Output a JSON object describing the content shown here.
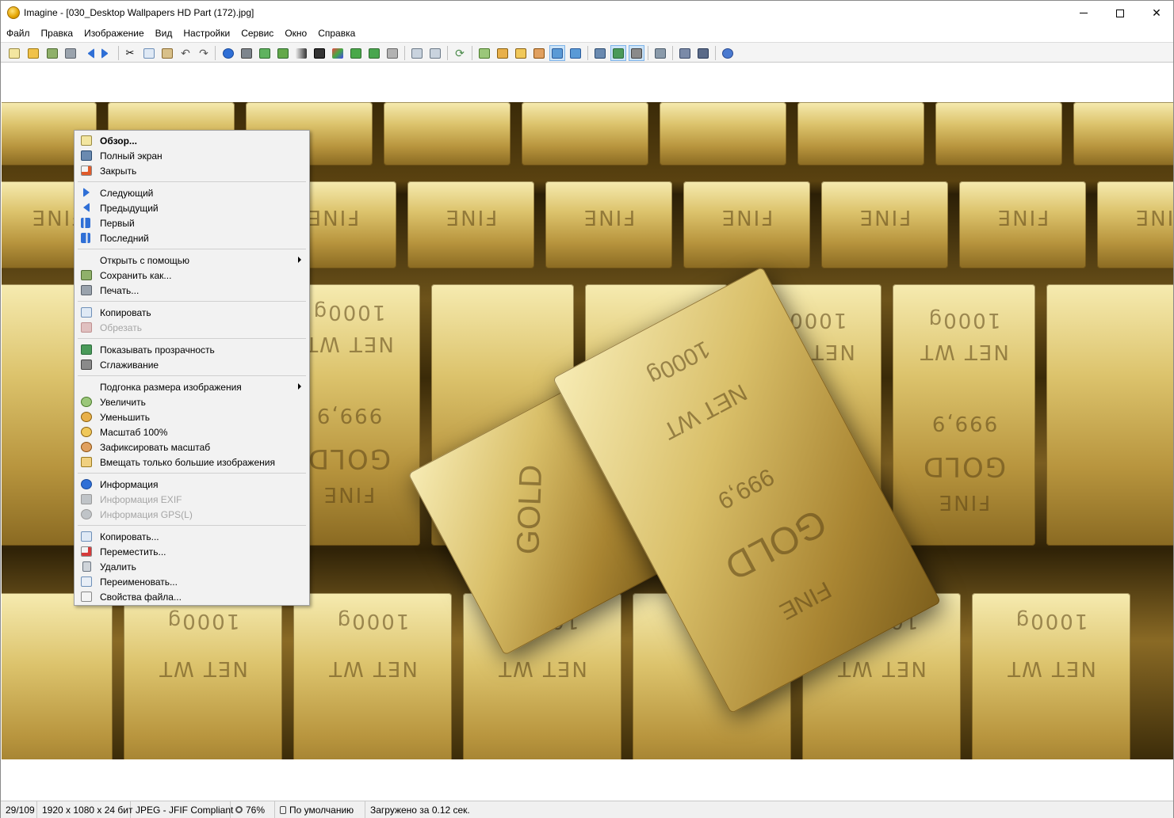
{
  "window": {
    "title": "Imagine - [030_Desktop Wallpapers  HD Part (172).jpg]"
  },
  "menubar": {
    "items": [
      "Файл",
      "Правка",
      "Изображение",
      "Вид",
      "Настройки",
      "Сервис",
      "Окно",
      "Справка"
    ]
  },
  "toolbar": {
    "icons": [
      "browse-icon",
      "open-icon",
      "save-icon",
      "print-icon",
      "previous-icon",
      "next-icon",
      "cut-icon",
      "copy-icon",
      "paste-icon",
      "undo-icon",
      "redo-icon",
      "info-icon",
      "exif-icon",
      "crop-icon",
      "print-preview-icon",
      "grayscale-icon",
      "negative-icon",
      "effects-icon",
      "rotate-icon",
      "flip-icon",
      "wand-icon",
      "zoom-in-icon",
      "zoom-out-icon",
      "refresh-icon",
      "zoom-tool-icon",
      "zoom-in-icon",
      "zoom-out-icon",
      "fit-icon",
      "fit-active-icon",
      "fit-large-icon",
      "fullscreen-icon",
      "slideshow-icon",
      "smooth-icon",
      "settings-icon",
      "screen-capture-icon",
      "batch-icon",
      "help-icon"
    ]
  },
  "context_menu": {
    "items": [
      {
        "label": "Обзор...",
        "icon": "browse-icon",
        "bold": true
      },
      {
        "label": "Полный экран",
        "icon": "monitor-icon"
      },
      {
        "label": "Закрыть",
        "icon": "close-doc-icon"
      },
      {
        "separator": true
      },
      {
        "label": "Следующий",
        "icon": "next-icon"
      },
      {
        "label": "Предыдущий",
        "icon": "previous-icon"
      },
      {
        "label": "Первый",
        "icon": "first-icon"
      },
      {
        "label": "Последний",
        "icon": "last-icon"
      },
      {
        "separator": true
      },
      {
        "label": "Открыть с помощью",
        "submenu": true
      },
      {
        "label": "Сохранить как...",
        "icon": "save-as-icon"
      },
      {
        "label": "Печать...",
        "icon": "print-icon"
      },
      {
        "separator": true
      },
      {
        "label": "Копировать",
        "icon": "copy-icon"
      },
      {
        "label": "Обрезать",
        "icon": "crop-icon",
        "disabled": true
      },
      {
        "separator": true
      },
      {
        "label": "Показывать прозрачность",
        "icon": "transparency-icon"
      },
      {
        "label": "Сглаживание",
        "icon": "smooth-icon"
      },
      {
        "separator": true
      },
      {
        "label": "Подгонка размера изображения",
        "submenu": true
      },
      {
        "label": "Увеличить",
        "icon": "zoom-in-icon"
      },
      {
        "label": "Уменьшить",
        "icon": "zoom-out-icon"
      },
      {
        "label": "Масштаб 100%",
        "icon": "zoom-100-icon"
      },
      {
        "label": "Зафиксировать масштаб",
        "icon": "zoom-lock-icon"
      },
      {
        "label": "Вмещать только большие изображения",
        "icon": "fit-large-icon"
      },
      {
        "separator": true
      },
      {
        "label": "Информация",
        "icon": "info-icon"
      },
      {
        "label": "Информация EXIF",
        "icon": "exif-icon",
        "disabled": true
      },
      {
        "label": "Информация GPS(L)",
        "icon": "gps-icon",
        "disabled": true
      },
      {
        "separator": true
      },
      {
        "label": "Копировать...",
        "icon": "copy-file-icon"
      },
      {
        "label": "Переместить...",
        "icon": "move-file-icon"
      },
      {
        "label": "Удалить",
        "icon": "delete-icon"
      },
      {
        "label": "Переименовать...",
        "icon": "rename-icon"
      },
      {
        "label": "Свойства файла...",
        "icon": "properties-icon"
      }
    ]
  },
  "photo": {
    "stamps": [
      "1000g",
      "NET WT",
      "999,9",
      "GOLD",
      "FINE"
    ]
  },
  "statusbar": {
    "index": "29/109",
    "dimensions": "1920 x 1080 x 24 бит",
    "format": "JPEG - JFIF Compliant",
    "zoom": "76%",
    "profile": "По умолчанию",
    "load_time": "Загружено за 0.12 сек."
  },
  "colors": {
    "accent": "#2f6fd6",
    "gold_light": "#f6ebb0",
    "gold_dark": "#8a6a22",
    "disabled_text": "#a5a5a5"
  }
}
